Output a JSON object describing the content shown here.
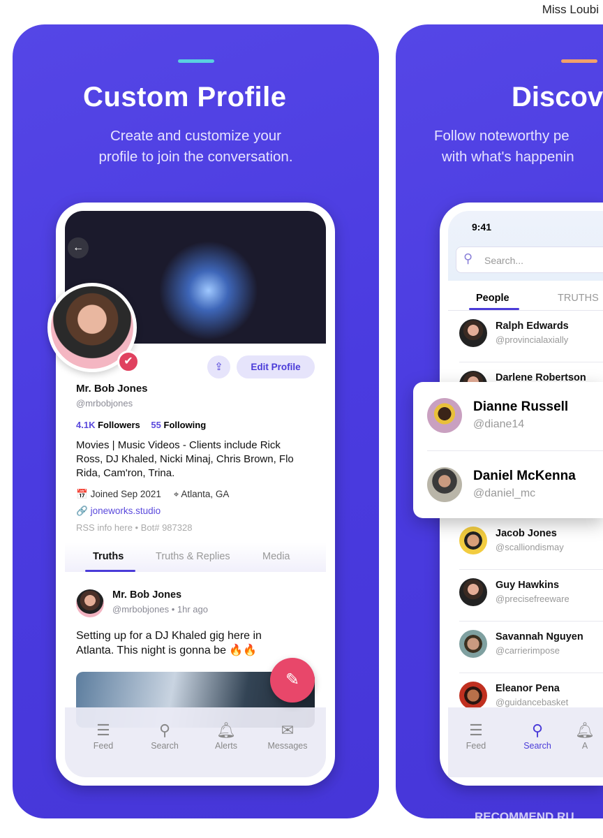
{
  "watermark_top": "Miss Loubi",
  "watermark_bottom": "RECOMMEND.RU",
  "colors": {
    "panel": "#4f40e0",
    "accent_left": "#5ad0e0",
    "accent_right": "#f2a06a",
    "brand": "#4a3bd8",
    "fab": "#e8476a"
  },
  "left_panel": {
    "title": "Custom Profile",
    "subtitle_line1": "Create and customize your",
    "subtitle_line2": "profile to join the conversation.",
    "profile": {
      "edit_label": "Edit Profile",
      "name": "Mr. Bob Jones",
      "handle": "@mrbobjones",
      "followers_count": "4.1K",
      "followers_label": "Followers",
      "following_count": "55",
      "following_label": "Following",
      "bio_line1": "Movies | Music Videos - Clients include Rick",
      "bio_line2": "Ross, DJ Khaled, Nicki Minaj, Chris Brown, Flo",
      "bio_line3": "Rida, Cam'ron, Trina.",
      "joined": "Joined Sep 2021",
      "location": "Atlanta, GA",
      "website": "joneworks.studio",
      "rss": "RSS info here",
      "bot": "Bot# 987328"
    },
    "tabs": [
      "Truths",
      "Truths & Replies",
      "Media"
    ],
    "post": {
      "name": "Mr. Bob Jones",
      "handle": "@mrbobjones",
      "time": "1hr ago",
      "text_line1": "Setting up for a DJ Khaled gig here in",
      "text_line2": "Atlanta. This night is gonna be 🔥🔥"
    },
    "nav": [
      "Feed",
      "Search",
      "Alerts",
      "Messages"
    ]
  },
  "right_panel": {
    "title": "Discov",
    "subtitle_line1": "Follow noteworthy pe",
    "subtitle_line2": "with what's happenin",
    "time": "9:41",
    "search_placeholder": "Search...",
    "tabs": [
      "People",
      "TRUTHS"
    ],
    "people": [
      {
        "name": "Ralph Edwards",
        "handle": "@provincialaxially"
      },
      {
        "name": "Darlene Robertson",
        "handle": ""
      },
      {
        "name": "Jacob Jones",
        "handle": "@scalliondismay"
      },
      {
        "name": "Guy Hawkins",
        "handle": "@precisefreeware"
      },
      {
        "name": "Savannah Nguyen",
        "handle": "@carrierimpose"
      },
      {
        "name": "Eleanor Pena",
        "handle": "@guidancebasket"
      }
    ],
    "featured": [
      {
        "name": "Dianne Russell",
        "handle": "@diane14"
      },
      {
        "name": "Daniel McKenna",
        "handle": "@daniel_mc"
      }
    ],
    "nav": [
      "Feed",
      "Search",
      "A"
    ]
  }
}
